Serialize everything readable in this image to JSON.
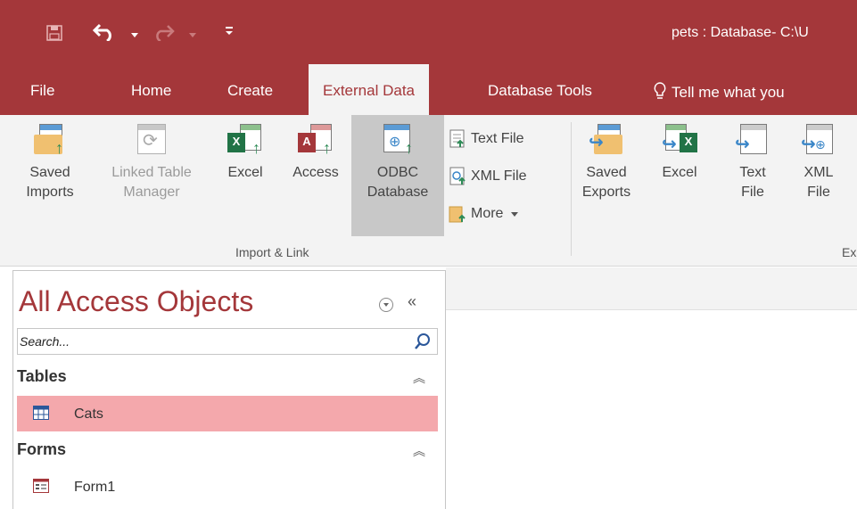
{
  "window": {
    "title": "pets : Database- C:\\U"
  },
  "quick_access": {
    "icons": [
      "save-icon",
      "undo-icon",
      "undo-dropdown-icon",
      "redo-icon",
      "redo-dropdown-icon",
      "customize-qat-icon"
    ]
  },
  "tabs": [
    {
      "label": "File"
    },
    {
      "label": "Home"
    },
    {
      "label": "Create"
    },
    {
      "label": "External Data",
      "active": true
    },
    {
      "label": "Database Tools"
    },
    {
      "label": "Tell me what you"
    }
  ],
  "ribbon": {
    "import_link": {
      "group_label": "Import & Link",
      "saved_imports": {
        "line1": "Saved",
        "line2": "Imports"
      },
      "linked_table_manager": {
        "line1": "Linked Table",
        "line2": "Manager"
      },
      "excel": {
        "label": "Excel"
      },
      "access": {
        "label": "Access"
      },
      "odbc": {
        "line1": "ODBC",
        "line2": "Database"
      },
      "text_file": {
        "label": "Text File"
      },
      "xml_file": {
        "label": "XML File"
      },
      "more": {
        "label": "More"
      }
    },
    "export": {
      "group_label": "Ex",
      "saved_exports": {
        "line1": "Saved",
        "line2": "Exports"
      },
      "excel": {
        "label": "Excel"
      },
      "text_file": {
        "line1": "Text",
        "line2": "File"
      },
      "xml_file": {
        "line1": "XML",
        "line2": "File"
      }
    }
  },
  "nav_pane": {
    "title": "All Access Objects",
    "search_placeholder": "Search...",
    "categories": [
      {
        "label": "Tables",
        "items": [
          {
            "label": "Cats",
            "selected": true
          }
        ]
      },
      {
        "label": "Forms",
        "items": [
          {
            "label": "Form1",
            "selected": false
          }
        ]
      }
    ]
  },
  "colors": {
    "accent": "#a4373a",
    "ribbon_bg": "#f3f3f3",
    "selected_item": "#f4a8ac"
  }
}
